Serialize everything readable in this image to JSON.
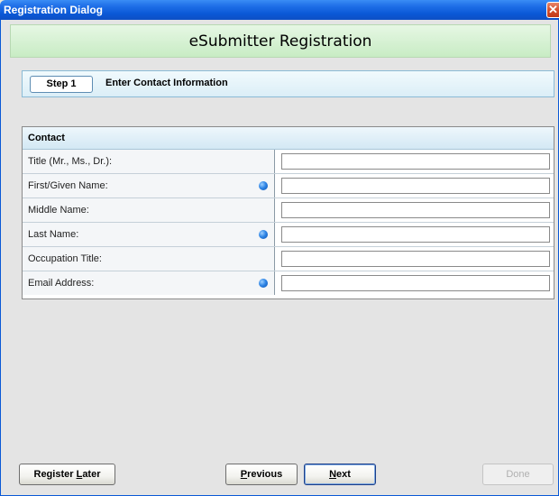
{
  "window": {
    "title": "Registration Dialog",
    "close_glyph": "✕"
  },
  "banner": {
    "title": "eSubmitter Registration"
  },
  "step": {
    "chip": "Step 1",
    "label": "Enter Contact Information"
  },
  "form": {
    "section_title": "Contact",
    "rows": [
      {
        "label": "Title (Mr., Ms., Dr.):",
        "required": false,
        "value": ""
      },
      {
        "label": "First/Given Name:",
        "required": true,
        "value": ""
      },
      {
        "label": "Middle Name:",
        "required": false,
        "value": ""
      },
      {
        "label": "Last Name:",
        "required": true,
        "value": ""
      },
      {
        "label": "Occupation Title:",
        "required": false,
        "value": ""
      },
      {
        "label": "Email Address:",
        "required": true,
        "value": ""
      }
    ]
  },
  "buttons": {
    "register_later": {
      "pre": "Register ",
      "mnemonic": "L",
      "post": "ater"
    },
    "previous": {
      "pre": "",
      "mnemonic": "P",
      "post": "revious"
    },
    "next": {
      "pre": "",
      "mnemonic": "N",
      "post": "ext"
    },
    "done": {
      "label": "Done"
    }
  },
  "icons": {
    "close": "close-icon",
    "required": "required-dot-icon"
  },
  "colors": {
    "title_bar": "#0a58d6",
    "banner": "#d4f0d0",
    "required_dot": "#2f86e6",
    "close": "#d4502c"
  }
}
